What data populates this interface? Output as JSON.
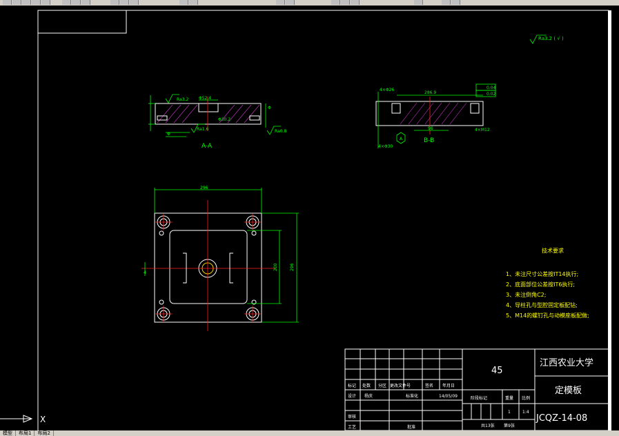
{
  "drawing": {
    "roughness_note": "Ra3.2 ( √ )",
    "section_aa_label": "A-A",
    "section_bb_label": "B-B",
    "dim_width": "296",
    "dim_height": "296",
    "dim_inner": "200",
    "tech_title": "技术要求",
    "tech_items": [
      "1、未注尺寸公差按IT14执行;",
      "2、底面部位公差按IT6执行;",
      "3、未注倒角C2;",
      "4、导柱孔与型腔固定板配钻;",
      "5、M14的螺钉孔与动模座板配做;"
    ]
  },
  "title_block": {
    "material": "45",
    "school": "江西农业大学",
    "part_name": "定模板",
    "drawing_number": "JCQZ-14-08",
    "row_labels": [
      "标记",
      "处数",
      "分区",
      "更改文件号",
      "签名",
      "年月日"
    ],
    "design_label": "设计",
    "designer": "杨庆",
    "standardize_label": "标准化",
    "date": "14/05/09",
    "stage_label": "阶段标记",
    "weight_label": "重量",
    "scale_label": "比例",
    "stage_value": "1",
    "scale_value": "1:4",
    "review_label": "审核",
    "process_label": "工艺",
    "approve_label": "批准",
    "total_sheets": "共13张",
    "sheet_no": "第9张"
  },
  "tabs": [
    "模型",
    "布局1",
    "布局2"
  ],
  "colors": {
    "lines": "#ffffff",
    "dims": "#00ff00",
    "center": "#ff2020",
    "hatch": "#cc33cc",
    "notes": "#ffff00"
  }
}
